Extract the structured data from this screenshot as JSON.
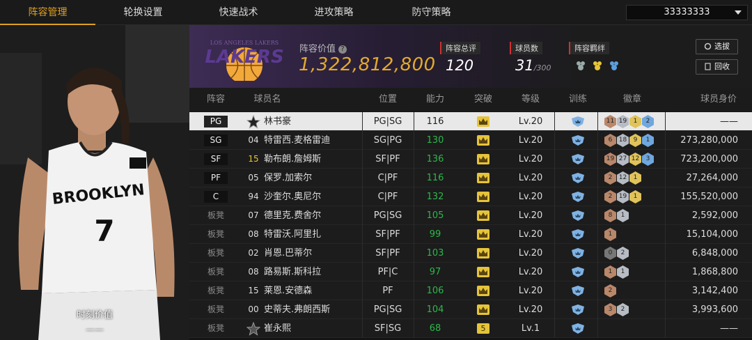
{
  "nav": {
    "tabs": [
      "阵容管理",
      "轮换设置",
      "快速战术",
      "进攻策略",
      "防守策略"
    ],
    "account": "33333333"
  },
  "player_card": {
    "value_label": "时刻价值",
    "value": "——"
  },
  "header": {
    "team_logo_text": "LOS ANGELES LAKERS",
    "value_label": "阵容价值",
    "value": "1,322,812,800",
    "rating_label": "阵容总评",
    "rating": "120",
    "players_label": "球员数",
    "players": "31",
    "players_max": "/300",
    "chemistry_label": "阵容羁绊",
    "btn_select": "选拔",
    "btn_recycle": "回收"
  },
  "columns": [
    "阵容",
    "球员名",
    "位置",
    "能力",
    "突破",
    "等级",
    "训练",
    "徽章",
    "球员身价"
  ],
  "colors": {
    "accent": "#e0a020",
    "value": "#e4a92e",
    "ability_green": "#2cb84a",
    "crown": "#e6c43a"
  },
  "rows": [
    {
      "slot": "PG",
      "num": "",
      "name": "林书豪",
      "pos": "PG|SG",
      "ability": "116",
      "breakthrough": "crown",
      "level": "Lv.20",
      "badges": [
        "11",
        "19",
        "1",
        "2"
      ],
      "price": "——",
      "selected": true,
      "star": true
    },
    {
      "slot": "SG",
      "num": "04",
      "name": "特雷西.麦格雷迪",
      "pos": "SG|PG",
      "ability": "130",
      "breakthrough": "crown",
      "level": "Lv.20",
      "badges": [
        "6",
        "18",
        "9",
        "1"
      ],
      "price": "273,280,000"
    },
    {
      "slot": "SF",
      "num": "15",
      "name": "勒布朗.詹姆斯",
      "pos": "SF|PF",
      "ability": "136",
      "breakthrough": "crown",
      "level": "Lv.20",
      "badges": [
        "19",
        "27",
        "12",
        "3"
      ],
      "price": "723,200,000"
    },
    {
      "slot": "PF",
      "num": "05",
      "name": "保罗.加索尔",
      "pos": "C|PF",
      "ability": "116",
      "breakthrough": "crown",
      "level": "Lv.20",
      "badges": [
        "2",
        "12",
        "1"
      ],
      "price": "27,264,000"
    },
    {
      "slot": "C",
      "num": "94",
      "name": "沙奎尔.奥尼尔",
      "pos": "C|PF",
      "ability": "132",
      "breakthrough": "crown",
      "level": "Lv.20",
      "badges": [
        "2",
        "19",
        "1"
      ],
      "price": "155,520,000"
    },
    {
      "slot": "板凳",
      "num": "07",
      "name": "德里克.费舍尔",
      "pos": "PG|SG",
      "ability": "105",
      "breakthrough": "crown",
      "level": "Lv.20",
      "badges": [
        "8",
        "1"
      ],
      "price": "2,592,000"
    },
    {
      "slot": "板凳",
      "num": "08",
      "name": "特雷沃.阿里扎",
      "pos": "SF|PF",
      "ability": "99",
      "breakthrough": "crown",
      "level": "Lv.20",
      "badges": [
        "1"
      ],
      "price": "15,104,000"
    },
    {
      "slot": "板凳",
      "num": "02",
      "name": "肖恩.巴蒂尔",
      "pos": "SF|PF",
      "ability": "103",
      "breakthrough": "crown",
      "level": "Lv.20",
      "badges": [
        "0",
        "2"
      ],
      "price": "6,848,000"
    },
    {
      "slot": "板凳",
      "num": "08",
      "name": "路易斯.斯科拉",
      "pos": "PF|C",
      "ability": "97",
      "breakthrough": "crown",
      "level": "Lv.20",
      "badges": [
        "1",
        "1"
      ],
      "price": "1,868,800"
    },
    {
      "slot": "板凳",
      "num": "15",
      "name": "莱恩.安德森",
      "pos": "PF",
      "ability": "106",
      "breakthrough": "crown",
      "level": "Lv.20",
      "badges": [
        "2"
      ],
      "price": "3,142,400"
    },
    {
      "slot": "板凳",
      "num": "00",
      "name": "史蒂夫.弗朗西斯",
      "pos": "PG|SG",
      "ability": "104",
      "breakthrough": "crown",
      "level": "Lv.20",
      "badges": [
        "3",
        "2"
      ],
      "price": "3,993,600"
    },
    {
      "slot": "板凳",
      "num": "",
      "name": "崔永熙",
      "pos": "SF|SG",
      "ability": "68",
      "breakthrough": "5",
      "level": "Lv.1",
      "badges": [],
      "price": "——",
      "star": true
    }
  ]
}
